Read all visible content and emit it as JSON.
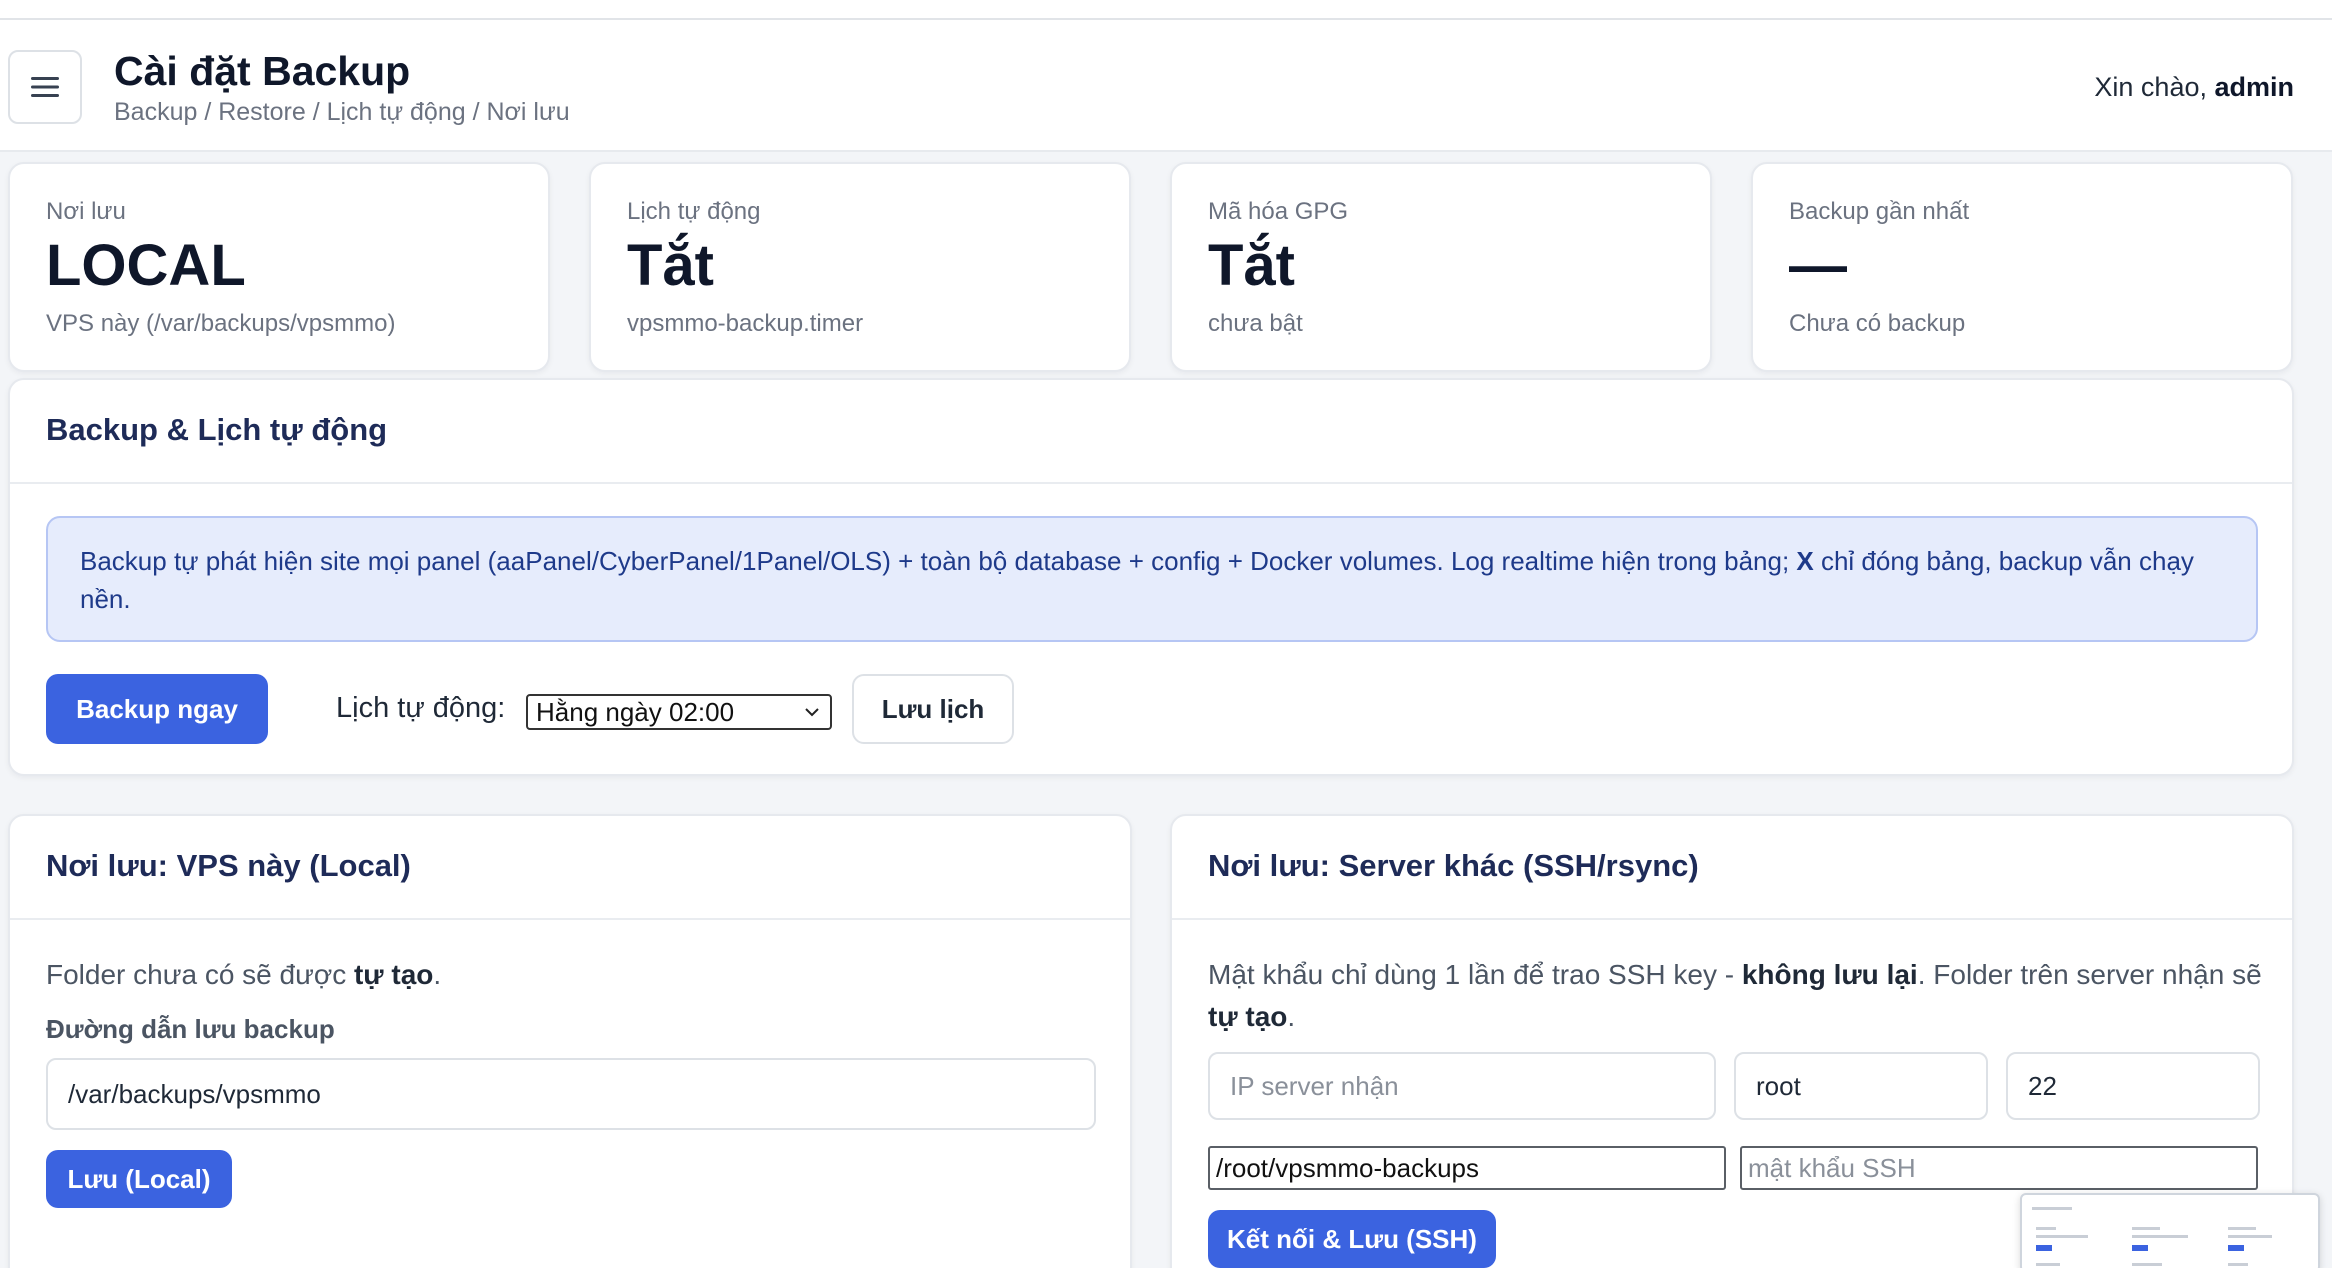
{
  "header": {
    "title": "Cài đặt Backup",
    "breadcrumb": "Backup / Restore / Lịch tự động / Nơi lưu",
    "greeting_prefix": "Xin chào, ",
    "username": "admin"
  },
  "stats": [
    {
      "label": "Nơi lưu",
      "value": "LOCAL",
      "sub": "VPS này (/var/backups/vpsmmo)"
    },
    {
      "label": "Lịch tự động",
      "value": "Tắt",
      "sub": "vpsmmo-backup.timer"
    },
    {
      "label": "Mã hóa GPG",
      "value": "Tắt",
      "sub": "chưa bật"
    },
    {
      "label": "Backup gần nhất",
      "value": "—",
      "sub": "Chưa có backup"
    }
  ],
  "backup_card": {
    "title": "Backup & Lịch tự động",
    "info_part1": "Backup tự phát hiện site mọi panel (aaPanel/CyberPanel/1Panel/OLS) + toàn bộ database + config + Docker volumes. Log realtime hiện trong bảng; ",
    "info_bold": "X",
    "info_part2": " chỉ đóng bảng, backup vẫn chạy nền.",
    "backup_now_label": "Backup ngay",
    "schedule_label": "Lịch tự động:",
    "schedule_value": "Hằng ngày 02:00",
    "save_schedule_label": "Lưu lịch"
  },
  "local_card": {
    "title": "Nơi lưu: VPS này (Local)",
    "desc_part1": "Folder chưa có sẽ được ",
    "desc_bold": "tự tạo",
    "desc_part2": ".",
    "path_label": "Đường dẫn lưu backup",
    "path_value": "/var/backups/vpsmmo",
    "save_label": "Lưu (Local)"
  },
  "ssh_card": {
    "title": "Nơi lưu: Server khác (SSH/rsync)",
    "desc_part1": "Mật khẩu chỉ dùng 1 lần để trao SSH key - ",
    "desc_bold1": "không lưu lại",
    "desc_part2": ". Folder trên server nhận sẽ ",
    "desc_bold2": "tự tạo",
    "desc_part3": ".",
    "ip_placeholder": "IP server nhận",
    "user_value": "root",
    "port_value": "22",
    "remote_path_value": "/root/vpsmmo-backups",
    "password_placeholder": "mật khẩu SSH",
    "connect_label": "Kết nối & Lưu (SSH)"
  },
  "icons": {
    "menu": "hamburger-menu-icon",
    "select_caret": "chevron-down-icon"
  },
  "colors": {
    "primary": "#3b63e0",
    "title_navy": "#1e2b58",
    "info_bg": "#e6ecfc"
  }
}
